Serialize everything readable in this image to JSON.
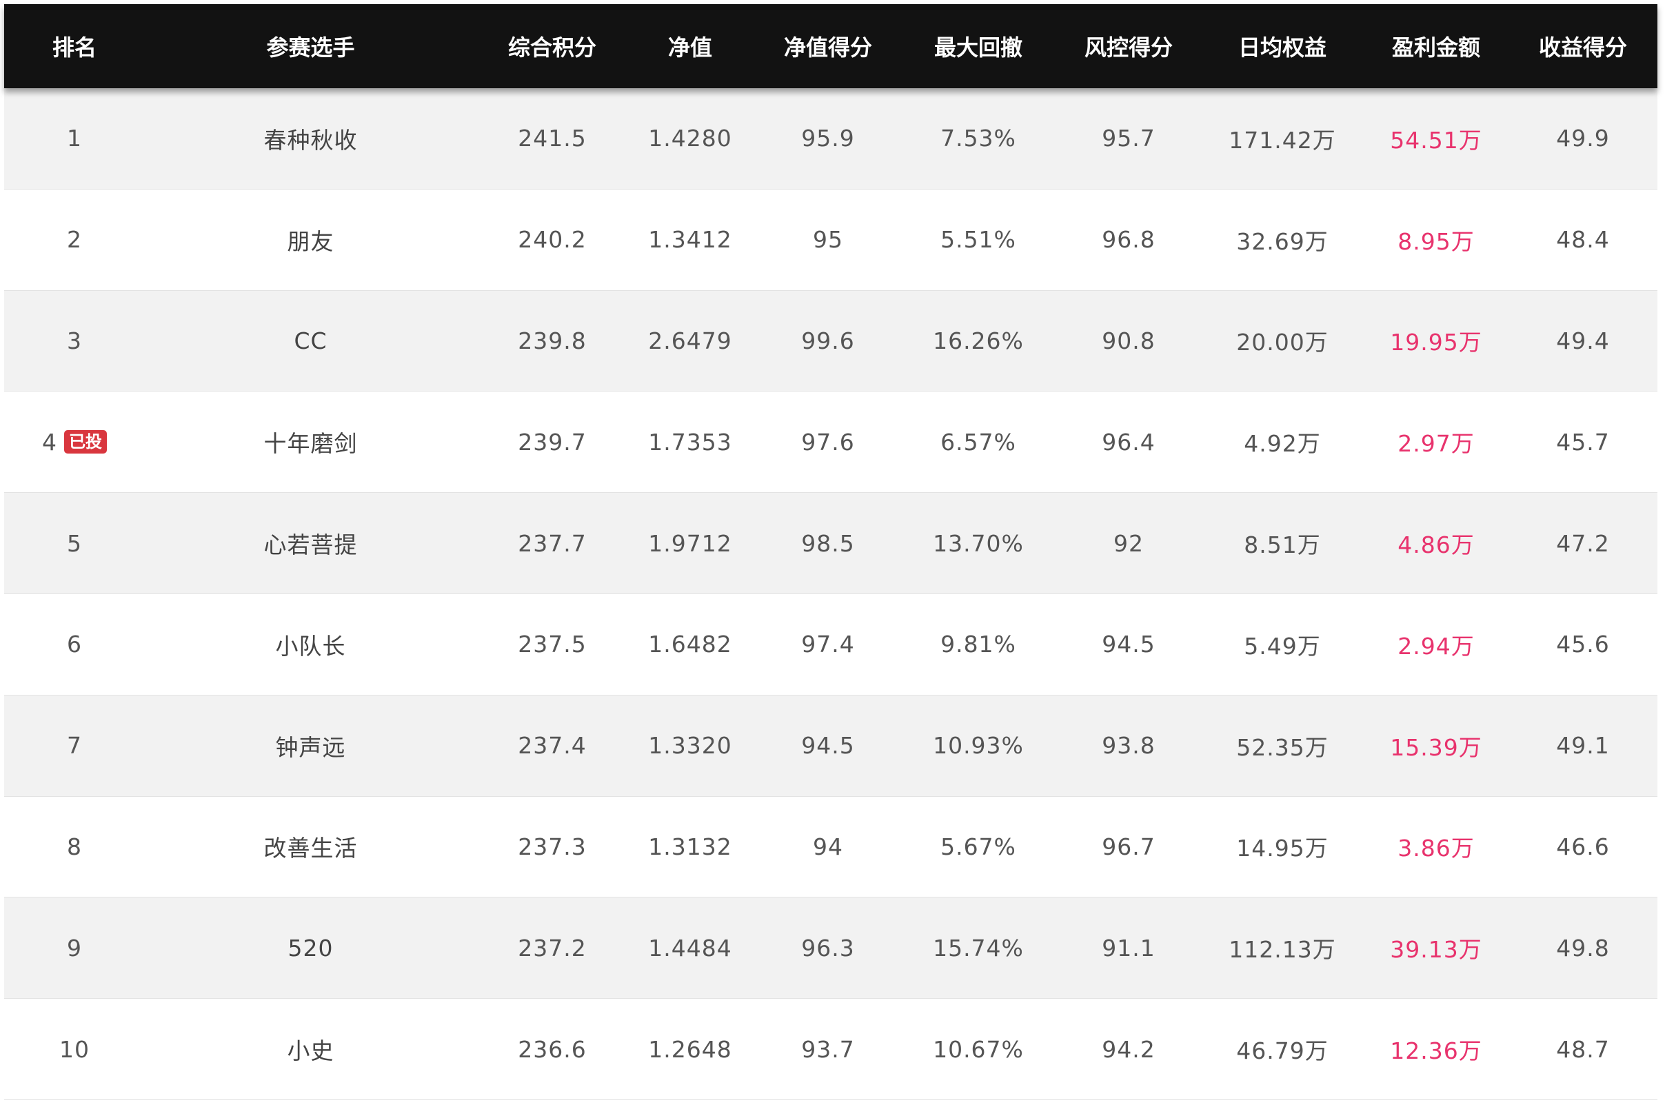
{
  "table": {
    "headers": [
      "排名",
      "参赛选手",
      "综合积分",
      "净值",
      "净值得分",
      "最大回撤",
      "风控得分",
      "日均权益",
      "盈利金额",
      "收益得分"
    ],
    "rows": [
      {
        "rank": "1",
        "badge": "",
        "name": "春种秋收",
        "score": "241.5",
        "nav": "1.4280",
        "nav_score": "95.9",
        "drawdown": "7.53%",
        "risk_score": "95.7",
        "daily_equity": "171.42万",
        "profit": "54.51万",
        "return_score": "49.9"
      },
      {
        "rank": "2",
        "badge": "",
        "name": "朋友",
        "score": "240.2",
        "nav": "1.3412",
        "nav_score": "95",
        "drawdown": "5.51%",
        "risk_score": "96.8",
        "daily_equity": "32.69万",
        "profit": "8.95万",
        "return_score": "48.4"
      },
      {
        "rank": "3",
        "badge": "",
        "name": "CC",
        "score": "239.8",
        "nav": "2.6479",
        "nav_score": "99.6",
        "drawdown": "16.26%",
        "risk_score": "90.8",
        "daily_equity": "20.00万",
        "profit": "19.95万",
        "return_score": "49.4"
      },
      {
        "rank": "4",
        "badge": "已投",
        "name": "十年磨剑",
        "score": "239.7",
        "nav": "1.7353",
        "nav_score": "97.6",
        "drawdown": "6.57%",
        "risk_score": "96.4",
        "daily_equity": "4.92万",
        "profit": "2.97万",
        "return_score": "45.7"
      },
      {
        "rank": "5",
        "badge": "",
        "name": "心若菩提",
        "score": "237.7",
        "nav": "1.9712",
        "nav_score": "98.5",
        "drawdown": "13.70%",
        "risk_score": "92",
        "daily_equity": "8.51万",
        "profit": "4.86万",
        "return_score": "47.2"
      },
      {
        "rank": "6",
        "badge": "",
        "name": "小队长",
        "score": "237.5",
        "nav": "1.6482",
        "nav_score": "97.4",
        "drawdown": "9.81%",
        "risk_score": "94.5",
        "daily_equity": "5.49万",
        "profit": "2.94万",
        "return_score": "45.6"
      },
      {
        "rank": "7",
        "badge": "",
        "name": "钟声远",
        "score": "237.4",
        "nav": "1.3320",
        "nav_score": "94.5",
        "drawdown": "10.93%",
        "risk_score": "93.8",
        "daily_equity": "52.35万",
        "profit": "15.39万",
        "return_score": "49.1"
      },
      {
        "rank": "8",
        "badge": "",
        "name": "改善生活",
        "score": "237.3",
        "nav": "1.3132",
        "nav_score": "94",
        "drawdown": "5.67%",
        "risk_score": "96.7",
        "daily_equity": "14.95万",
        "profit": "3.86万",
        "return_score": "46.6"
      },
      {
        "rank": "9",
        "badge": "",
        "name": "520",
        "score": "237.2",
        "nav": "1.4484",
        "nav_score": "96.3",
        "drawdown": "15.74%",
        "risk_score": "91.1",
        "daily_equity": "112.13万",
        "profit": "39.13万",
        "return_score": "49.8"
      },
      {
        "rank": "10",
        "badge": "",
        "name": "小史",
        "score": "236.6",
        "nav": "1.2648",
        "nav_score": "93.7",
        "drawdown": "10.67%",
        "risk_score": "94.2",
        "daily_equity": "46.79万",
        "profit": "12.36万",
        "return_score": "48.7"
      }
    ]
  },
  "colors": {
    "header_bg": "#121212",
    "profit": "#e8336d",
    "badge": "#d9363e",
    "row_alt": "#f2f2f2"
  }
}
